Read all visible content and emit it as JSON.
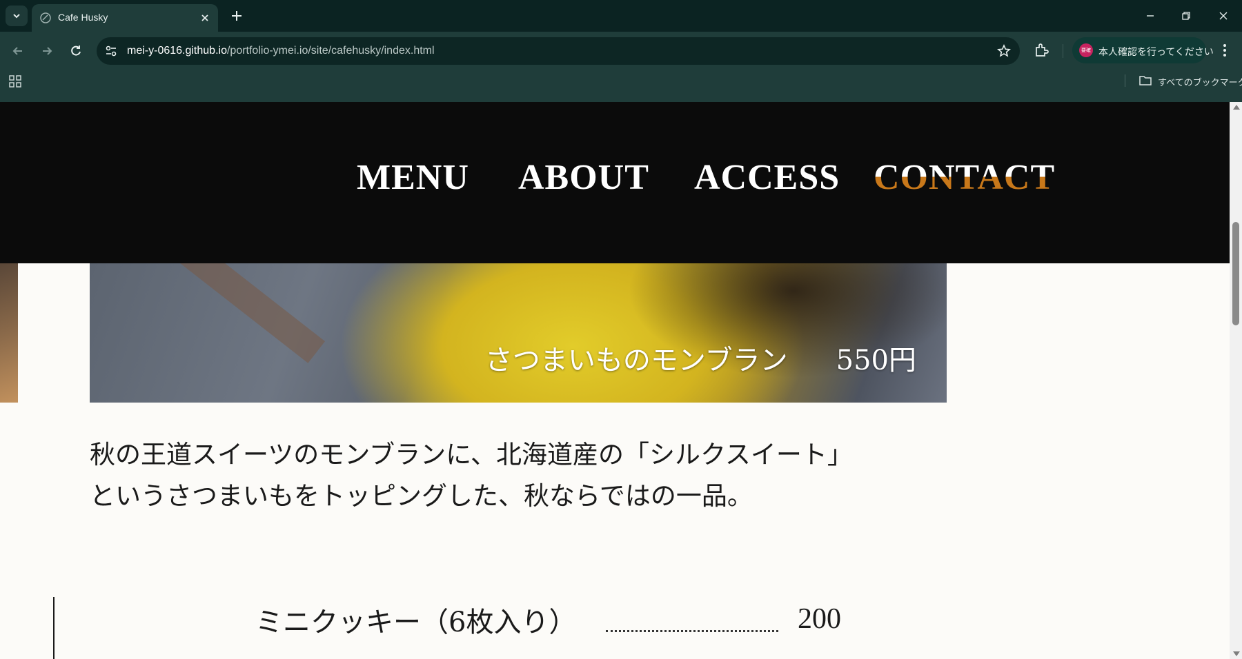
{
  "browser": {
    "tab": {
      "title": "Cafe Husky"
    },
    "url": {
      "host": "mei-y-0616.github.io",
      "path": "/portfolio-ymei.io/site/cafehusky/index.html"
    },
    "profile_label": "本人確認を行ってください",
    "profile_badge": "要確",
    "bookmarks_label": "すべてのブックマーク"
  },
  "site": {
    "nav": [
      "MENU",
      "ABOUT",
      "ACCESS",
      "CONTACT"
    ],
    "hero_caption": {
      "name": "さつまいものモンブラン",
      "price": "550円"
    },
    "description": [
      "秋の王道スイーツのモンブランに、北海道産の「シルクスイート」",
      "というさつまいもをトッピングした、秋ならではの一品。"
    ],
    "menu_item": {
      "name": "ミニクッキー（6枚入り）",
      "price": "200"
    }
  },
  "colors": {
    "chrome_dark": "#0b2322",
    "chrome_toolbar": "#1f3d3a",
    "header_bg": "#0b0b0b",
    "accent_contact": "#c8781a",
    "page_bg": "#fcfbf8"
  }
}
